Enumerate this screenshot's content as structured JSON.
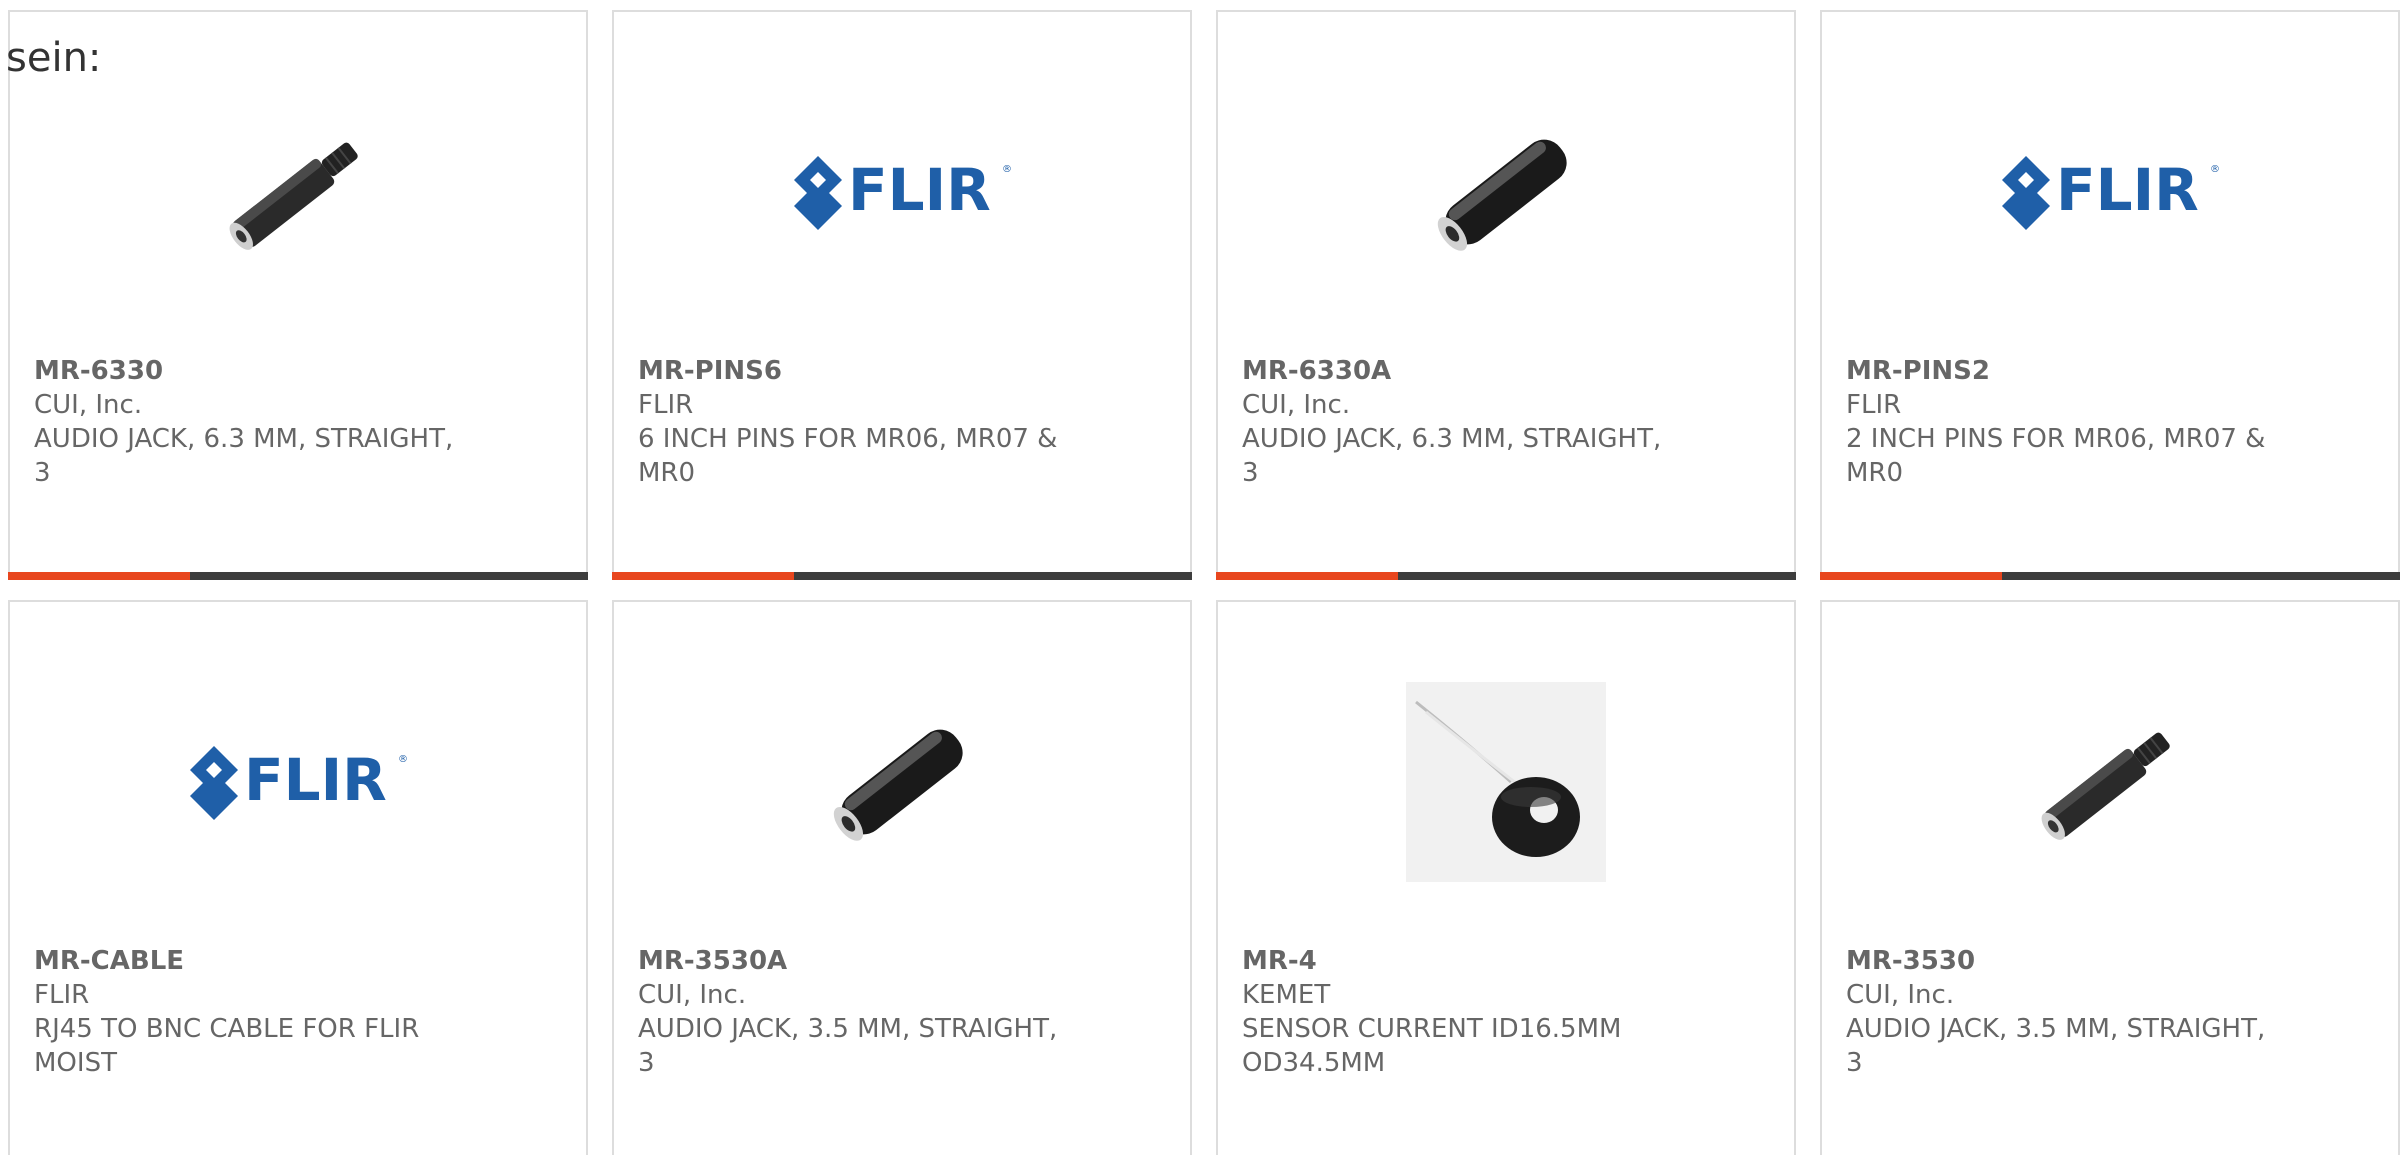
{
  "intro_text": "sein:",
  "accent_color": "#e8461e",
  "bar_color": "#3d3d3d",
  "products": [
    {
      "part_number": "MR-6330",
      "manufacturer": "CUI, Inc.",
      "description": "AUDIO JACK, 6.3 MM, STRAIGHT, 3",
      "image": "audio-jack-long-image"
    },
    {
      "part_number": "MR-PINS6",
      "manufacturer": "FLIR",
      "description": "6 INCH PINS FOR MR06, MR07 & MR0",
      "image": "flir-logo-image"
    },
    {
      "part_number": "MR-6330A",
      "manufacturer": "CUI, Inc.",
      "description": "AUDIO JACK, 6.3 MM, STRAIGHT, 3",
      "image": "audio-jack-thick-image"
    },
    {
      "part_number": "MR-PINS2",
      "manufacturer": "FLIR",
      "description": "2 INCH PINS FOR MR06, MR07 & MR0",
      "image": "flir-logo-image"
    },
    {
      "part_number": "MR-CABLE",
      "manufacturer": "FLIR",
      "description": "RJ45 TO BNC CABLE FOR FLIR MOIST",
      "image": "flir-logo-image"
    },
    {
      "part_number": "MR-3530A",
      "manufacturer": "CUI, Inc.",
      "description": "AUDIO JACK, 3.5 MM, STRAIGHT, 3",
      "image": "audio-jack-thick-image"
    },
    {
      "part_number": "MR-4",
      "manufacturer": "KEMET",
      "description": "SENSOR CURRENT ID16.5MM OD34.5MM",
      "image": "current-sensor-image"
    },
    {
      "part_number": "MR-3530",
      "manufacturer": "CUI, Inc.",
      "description": "AUDIO JACK, 3.5 MM, STRAIGHT, 3",
      "image": "audio-jack-long-image"
    }
  ],
  "logo_text": "FLIR"
}
